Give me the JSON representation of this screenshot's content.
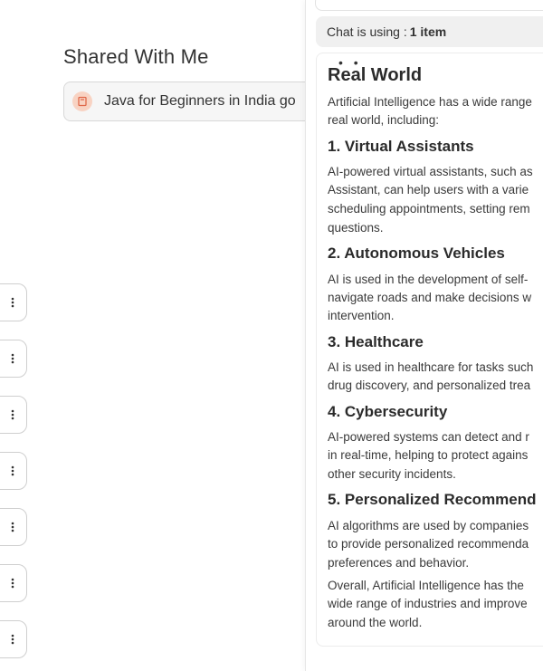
{
  "shared": {
    "title": "Shared With Me",
    "item_label": "Java for Beginners in India go"
  },
  "chat": {
    "using_prefix": "Chat is using :",
    "using_count": "1 item",
    "dots": "• •",
    "sections": {
      "intro_heading": "Real World",
      "intro_text_1": "Artificial Intelligence has a wide range",
      "intro_text_2": "real world, including:",
      "h1": "1. Virtual Assistants",
      "p1_1": "AI-powered virtual assistants, such as",
      "p1_2": "Assistant, can help users with a varie",
      "p1_3": "scheduling appointments, setting rem",
      "p1_4": "questions.",
      "h2": "2. Autonomous Vehicles",
      "p2_1": "AI is used in the development of self-",
      "p2_2": "navigate roads and make decisions w",
      "p2_3": "intervention.",
      "h3": "3. Healthcare",
      "p3_1": "AI is used in healthcare for tasks such",
      "p3_2": "drug discovery, and personalized trea",
      "h4": "4. Cybersecurity",
      "p4_1": "AI-powered systems can detect and r",
      "p4_2": "in real-time, helping to protect agains",
      "p4_3": "other security incidents.",
      "h5": "5. Personalized Recommend",
      "p5_1": "AI algorithms are used by companies",
      "p5_2": "to provide personalized recommenda",
      "p5_3": "preferences and behavior.",
      "p6_1": "Overall, Artificial Intelligence has the",
      "p6_2": "wide range of industries and improve",
      "p6_3": "around the world."
    }
  },
  "icons": {
    "file": "bookmark-file-icon",
    "menu": "more-vertical-icon"
  },
  "colors": {
    "file_badge_bg": "#f8d3c3",
    "file_badge_fg": "#e0684a"
  }
}
